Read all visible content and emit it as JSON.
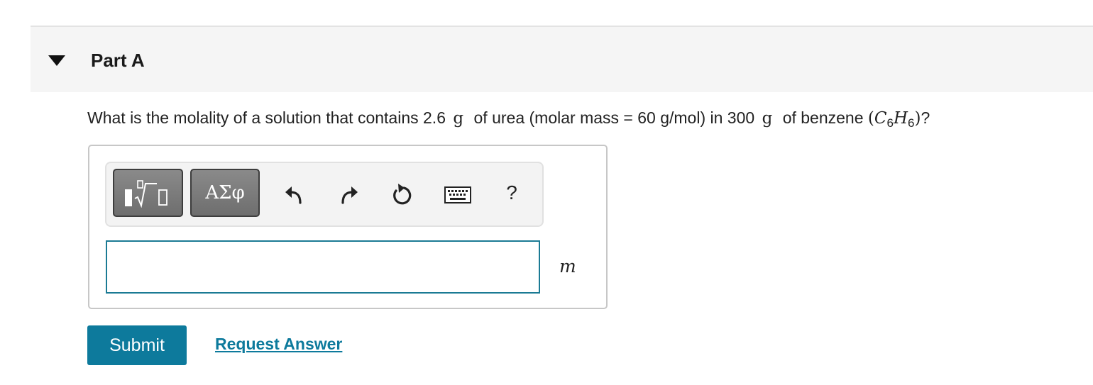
{
  "part": {
    "title": "Part A",
    "toggle_icon": "caret-down-icon"
  },
  "question": {
    "prefix": "What is the molality of a solution that contains 2.6",
    "unit1": "g",
    "middle": "of urea (molar mass = 60 g/mol) in 300",
    "unit2": "g",
    "suffix_text": "of benzene",
    "formula_open": "(",
    "formula_c": "C",
    "formula_c_sub": "6",
    "formula_h": "H",
    "formula_h_sub": "6",
    "formula_close": ")",
    "question_mark": "?"
  },
  "toolbar": {
    "templates_icon": "templates-icon",
    "symbols_label": "ΑΣφ",
    "undo_icon": "undo-icon",
    "redo_icon": "redo-icon",
    "reset_icon": "reset-icon",
    "keyboard_icon": "keyboard-icon",
    "help_label": "?"
  },
  "answer": {
    "value": "",
    "unit": "m"
  },
  "actions": {
    "submit_label": "Submit",
    "request_answer_label": "Request Answer"
  },
  "colors": {
    "accent": "#0d7a9c",
    "input_border": "#1b7a94",
    "header_bg": "#f5f5f5"
  }
}
